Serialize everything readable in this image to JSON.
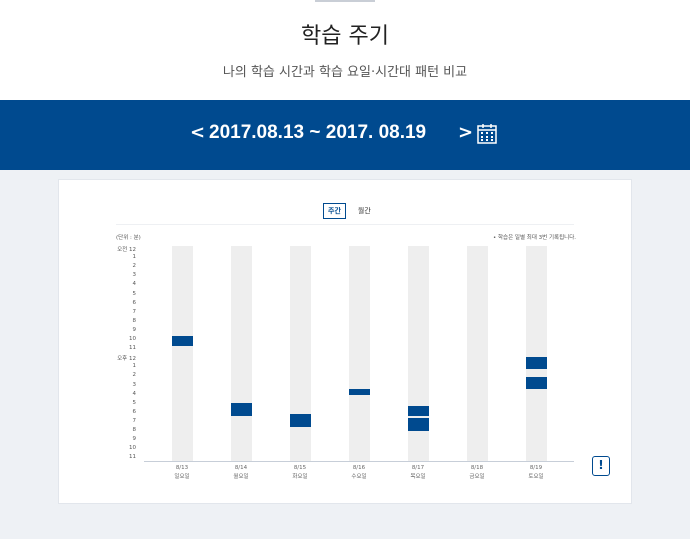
{
  "header": {
    "title": "학습 주기",
    "subtitle": "나의 학습 시간과 학습 요일·시간대 패턴 비교"
  },
  "date_nav": {
    "prev_label": "<",
    "range_label": "2017.08.13 ~ 2017. 08.19",
    "next_label": ">",
    "calendar_icon": "calendar-icon"
  },
  "tabs": [
    {
      "label": "주간",
      "active": true
    },
    {
      "label": "월간",
      "active": false
    }
  ],
  "chart_meta": {
    "unit_label": "(단위 : 분)",
    "note": "• 학습은 일별 최대 3번 기록됩니다."
  },
  "info_button_icon": "info-icon",
  "colors": {
    "accent": "#004a8f",
    "column_bg": "#eeeeee",
    "page_bg": "#eef1f5"
  },
  "chart_data": {
    "type": "bar",
    "y_labels": [
      "오전 12",
      "1",
      "2",
      "3",
      "4",
      "5",
      "6",
      "7",
      "8",
      "9",
      "10",
      "11",
      "오후 12",
      "1",
      "2",
      "3",
      "4",
      "5",
      "6",
      "7",
      "8",
      "9",
      "10",
      "11"
    ],
    "ylim": [
      0,
      24
    ],
    "categories": [
      {
        "date": "8/13",
        "day": "일요일",
        "sessions": [
          [
            10.1,
            11.2
          ]
        ]
      },
      {
        "date": "8/14",
        "day": "월요일",
        "sessions": [
          [
            17.5,
            19.0
          ]
        ]
      },
      {
        "date": "8/15",
        "day": "화요일",
        "sessions": [
          [
            18.8,
            20.2
          ]
        ]
      },
      {
        "date": "8/16",
        "day": "수요일",
        "sessions": [
          [
            16.0,
            16.6
          ]
        ]
      },
      {
        "date": "8/17",
        "day": "목요일",
        "sessions": [
          [
            17.9,
            19.0
          ],
          [
            19.2,
            20.7
          ]
        ]
      },
      {
        "date": "8/18",
        "day": "금요일",
        "sessions": []
      },
      {
        "date": "8/19",
        "day": "토요일",
        "sessions": [
          [
            12.4,
            13.7
          ],
          [
            14.6,
            16.0
          ]
        ]
      }
    ]
  }
}
